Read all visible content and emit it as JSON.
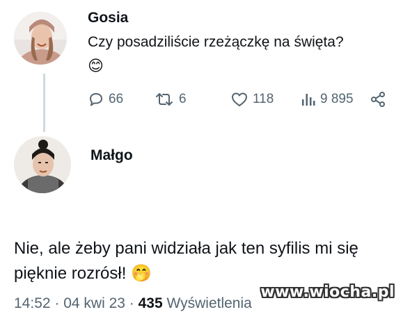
{
  "post": {
    "author": "Gosia",
    "text": "Czy posadziliście rzeżączkę na święta?",
    "emoji": "😊",
    "stats": {
      "replies": "66",
      "reposts": "6",
      "likes": "118",
      "views": "9 895"
    }
  },
  "reply": {
    "author": "Małgo",
    "text": "Nie, ale żeby pani widziała jak ten syfilis mi się pięknie rozrósł!",
    "emoji": "🤭",
    "meta": {
      "time": "14:52 · 04 kwi 23 · ",
      "views_count": "435",
      "views_label": " Wyświetlenia"
    }
  },
  "watermark": "www.wiocha.pl",
  "colors": {
    "text": "#0f1419",
    "secondary": "#536471",
    "thread_line": "#cfd9de"
  }
}
